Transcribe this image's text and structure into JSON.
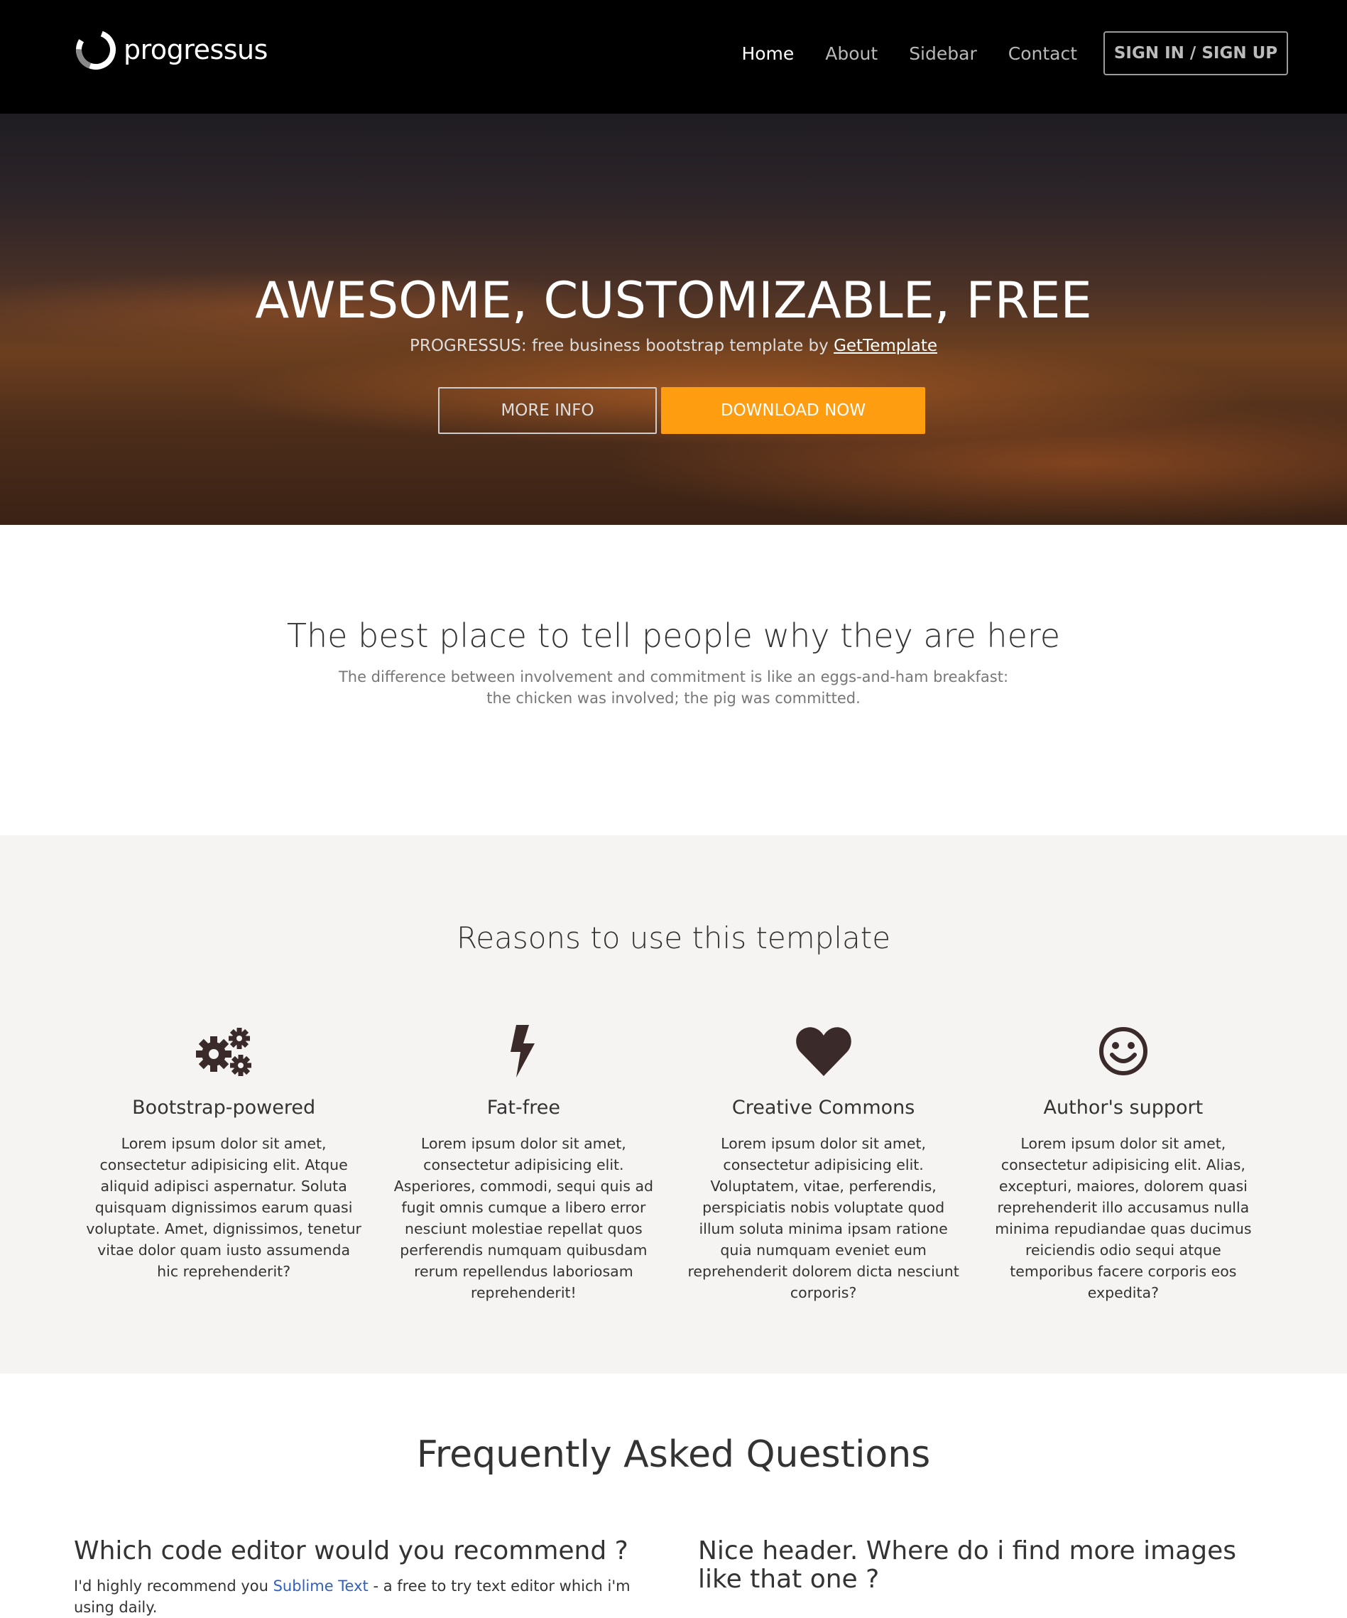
{
  "navbar": {
    "brand": "progressus",
    "items": [
      {
        "label": "Home",
        "active": true
      },
      {
        "label": "About",
        "active": false
      },
      {
        "label": "Sidebar",
        "active": false
      },
      {
        "label": "Contact",
        "active": false
      }
    ],
    "signin_label": "SIGN IN / SIGN UP"
  },
  "hero": {
    "title": "AWESOME, CUSTOMIZABLE, FREE",
    "subtitle_prefix": "PROGRESSUS: free business bootstrap template by ",
    "subtitle_link": "GetTemplate",
    "more_info_label": "MORE INFO",
    "download_label": "DOWNLOAD NOW"
  },
  "intro": {
    "title": "The best place to tell people why they are here",
    "line1": "The difference between involvement and commitment is like an eggs-and-ham breakfast:",
    "line2": "the chicken was involved; the pig was committed."
  },
  "reasons": {
    "title": "Reasons to use this template",
    "features": [
      {
        "icon": "gears-icon",
        "title": "Bootstrap-powered",
        "text": "Lorem ipsum dolor sit amet, consectetur adipisicing elit. Atque aliquid adipisci aspernatur. Soluta quisquam dignissimos earum quasi voluptate. Amet, dignissimos, tenetur vitae dolor quam iusto assumenda hic reprehenderit?"
      },
      {
        "icon": "bolt-icon",
        "title": "Fat-free",
        "text": "Lorem ipsum dolor sit amet, consectetur adipisicing elit. Asperiores, commodi, sequi quis ad fugit omnis cumque a libero error nesciunt molestiae repellat quos perferendis numquam quibusdam rerum repellendus laboriosam reprehenderit!"
      },
      {
        "icon": "heart-icon",
        "title": "Creative Commons",
        "text": "Lorem ipsum dolor sit amet, consectetur adipisicing elit. Voluptatem, vitae, perferendis, perspiciatis nobis voluptate quod illum soluta minima ipsam ratione quia numquam eveniet eum reprehenderit dolorem dicta nesciunt corporis?"
      },
      {
        "icon": "smile-icon",
        "title": "Author's support",
        "text": "Lorem ipsum dolor sit amet, consectetur adipisicing elit. Alias, excepturi, maiores, dolorem quasi reprehenderit illo accusamus nulla minima repudiandae quas ducimus reiciendis odio sequi atque temporibus facere corporis eos expedita?"
      }
    ]
  },
  "faq": {
    "title": "Frequently Asked Questions",
    "q1": {
      "question": "Which code editor would you recommend ?",
      "answer_prefix": "I'd highly recommend you ",
      "answer_link": "Sublime Text",
      "answer_suffix": " - a free to try text editor which i'm using daily."
    },
    "q2": {
      "question": "Nice header. Where do i find more images like that one ?"
    }
  },
  "colors": {
    "accent": "#fe9d10",
    "navbar_bg": "#000000",
    "reasons_bg": "#f5f4f2",
    "link": "#3060c0"
  }
}
